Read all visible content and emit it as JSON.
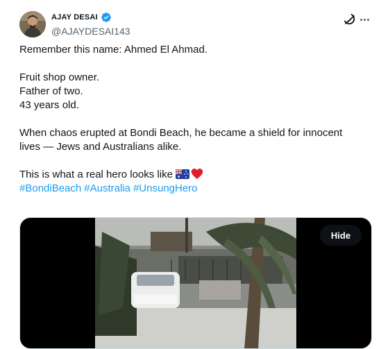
{
  "author": {
    "display_name": "AJAY DESAI",
    "handle": "@AJAYDESAI143",
    "avatar_icon": "avatar-photo",
    "verified_icon": "verified-badge-icon",
    "verified_color": "#1d9bf0"
  },
  "actions": {
    "grok_icon": "grok-icon",
    "more_icon": "more-icon"
  },
  "post": {
    "line1": "Remember this name: Ahmed El Ahmad.",
    "line2": "Fruit shop owner.",
    "line3": "Father of two.",
    "line4": "43 years old.",
    "line5": "When chaos erupted at Bondi Beach, he became a shield for innocent",
    "line6": "lives — Jews and Australians alike.",
    "line7": "This is what a real hero looks like",
    "line7_icons": [
      "australia-flag-icon",
      "red-heart-icon"
    ],
    "hashtags": [
      "#BondiBeach",
      "#Australia",
      "#UnsungHero"
    ],
    "link_color": "#1d9bf0"
  },
  "media": {
    "hide_label": "Hide"
  }
}
